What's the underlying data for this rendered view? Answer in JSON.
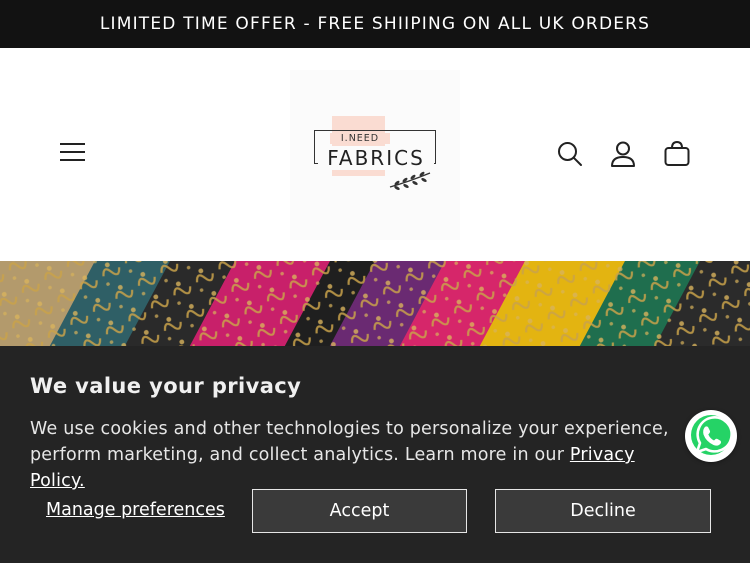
{
  "announcement": {
    "text": "LIMITED TIME OFFER - FREE SHIIPING ON ALL UK ORDERS"
  },
  "header": {
    "logo": {
      "line1": "I.NEED",
      "line2": "FABRICS"
    },
    "icons": [
      "menu-icon",
      "search-icon",
      "account-icon",
      "cart-icon"
    ]
  },
  "consent": {
    "title": "We value your privacy",
    "body": "We use cookies and other technologies to personalize your experience, perform marketing, and collect analytics. Learn more in our ",
    "link": "Privacy Policy.",
    "manage_label": "Manage preferences",
    "accept_label": "Accept",
    "decline_label": "Decline"
  },
  "colors": {
    "announcement_bg": "#121212",
    "consent_bg": "#242424",
    "button_bg": "#3a3a3a",
    "logo_pink": "#fadcd2",
    "whatsapp_green": "#25d366"
  }
}
